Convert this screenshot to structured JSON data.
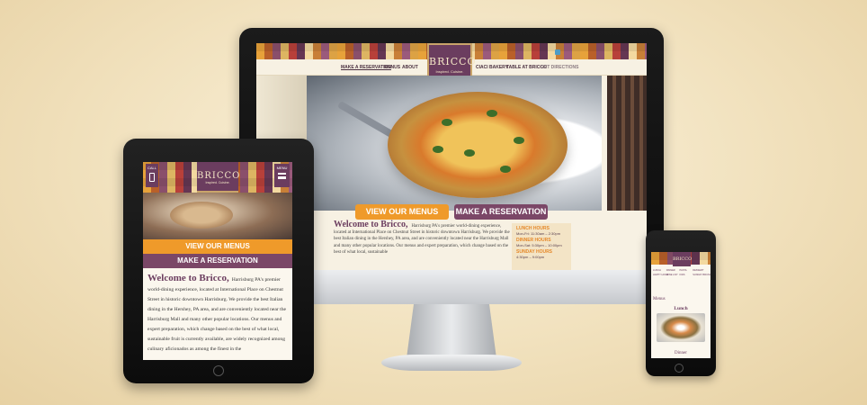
{
  "brand": {
    "name": "BRICCO",
    "tagline": "Inspired. Cuisine."
  },
  "colors": {
    "background": "#f1e1bd",
    "orange": "#ef9a2a",
    "plum": "#7b4767",
    "logo_bg": "#6b3d5f"
  },
  "desktop": {
    "nav_left": [
      "MAKE A RESERVATION",
      "MENUS",
      "ABOUT"
    ],
    "nav_right": [
      "CIACI BAKERY",
      "TABLE AT BRICCO",
      "GET DIRECTIONS"
    ],
    "social_icons": [
      "facebook-icon",
      "twitter-icon",
      "instagram-icon",
      "youtube-icon"
    ],
    "btn_menus": "VIEW OUR MENUS",
    "btn_reservation": "MAKE A RESERVATION",
    "welcome_title": "Welcome to Bricco,",
    "welcome_body": "Harrisburg PA's premier world-dining experience, located at International Place on Chestnut Street in historic downtown Harrisburg. We provide the best Italian dining in the Hershey, PA area, and are conveniently located near the Harrisburg Mall and many other popular locations. Our menus and expert preparation, which change based on the best of what local, sustainable",
    "hours": [
      {
        "label": "LUNCH HOURS",
        "time": "Mon-Fri: 11:30am – 2:30pm"
      },
      {
        "label": "DINNER HOURS",
        "time": "Mon-Sat: 5:30pm – 10:00pm"
      },
      {
        "label": "SUNDAY HOURS",
        "time": "4:30pm – 9:00pm"
      }
    ]
  },
  "tablet": {
    "call_label": "CALL",
    "menu_label": "MENU",
    "btn_menus": "VIEW OUR MENUS",
    "btn_reservation": "MAKE A RESERVATION",
    "welcome_title": "Welcome to Bricco,",
    "welcome_body": "Harrisburg PA's premier world-dining experience, located at International Place on Chestnut Street in historic downtown Harrisburg. We provide the best Italian dining in the Hershey, PA area, and are conveniently located near the Harrisburg Mall and many other popular locations. Our menus and expert preparation, which change based on the best of what local, sustainable fruit is currently available, are widely recognized among culinary aficionados as among the finest in the"
  },
  "phone": {
    "nav_items": [
      "LUNCH",
      "DINNER",
      "PASTA",
      "DESSERT",
      "HAPPY HOUR",
      "WINE LIST",
      "KIDS",
      "SUNDAY BRUNCH"
    ],
    "section_title": "Menus",
    "lunch_title": "Lunch",
    "dinner_title": "Dinner"
  }
}
